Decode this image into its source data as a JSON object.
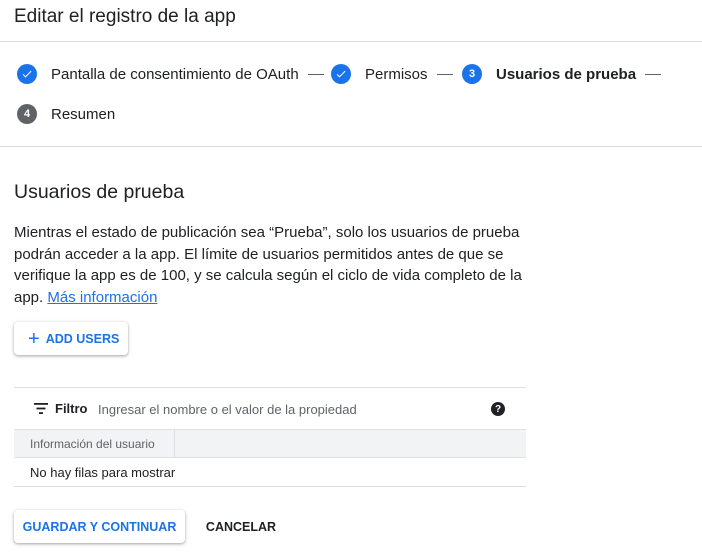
{
  "header": {
    "title": "Editar el registro de la app"
  },
  "stepper": {
    "steps": [
      {
        "label": "Pantalla de consentimiento de OAuth",
        "state": "done",
        "icon": "check-icon"
      },
      {
        "label": "Permisos",
        "state": "done",
        "icon": "check-icon"
      },
      {
        "number": "3",
        "label": "Usuarios de prueba",
        "state": "active"
      },
      {
        "number": "4",
        "label": "Resumen",
        "state": "pending"
      }
    ]
  },
  "section": {
    "title": "Usuarios de prueba",
    "description": "Mientras el estado de publicación sea “Prueba”, solo los usuarios de prueba podrán acceder a la app. El límite de usuarios permitidos antes de que se verifique la app es de 100, y se calcula según el ciclo de vida completo de la app.",
    "link": "Más información"
  },
  "add_users": {
    "label": "ADD USERS",
    "icon": "plus-icon"
  },
  "table": {
    "filter_label": "Filtro",
    "filter_placeholder": "Ingresar el nombre o el valor de la propiedad",
    "help_icon": "question-circle-icon",
    "columns": [
      "Información del usuario"
    ],
    "empty_message": "No hay filas para mostrar"
  },
  "actions": {
    "save": "GUARDAR Y CONTINUAR",
    "cancel": "CANCELAR"
  },
  "colors": {
    "accent": "#1a73e8",
    "pending": "#5f6368",
    "text": "#202124"
  }
}
